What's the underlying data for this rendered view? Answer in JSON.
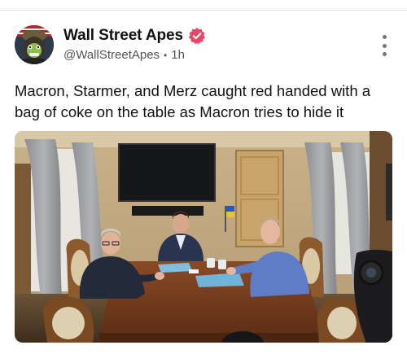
{
  "post": {
    "author_name": "Wall Street Apes",
    "handle": "@WallStreetApes",
    "separator": "•",
    "time": "1h",
    "text": "Macron, Starmer, and Merz caught red handed with a bag of coke on the table as Macron tries to hide it"
  },
  "icons": {
    "verified": "verified-badge-icon",
    "more": "more-vertical-icon"
  },
  "colors": {
    "verified_badge": "#e8456b",
    "text_primary": "#111111",
    "text_secondary": "#555555"
  }
}
